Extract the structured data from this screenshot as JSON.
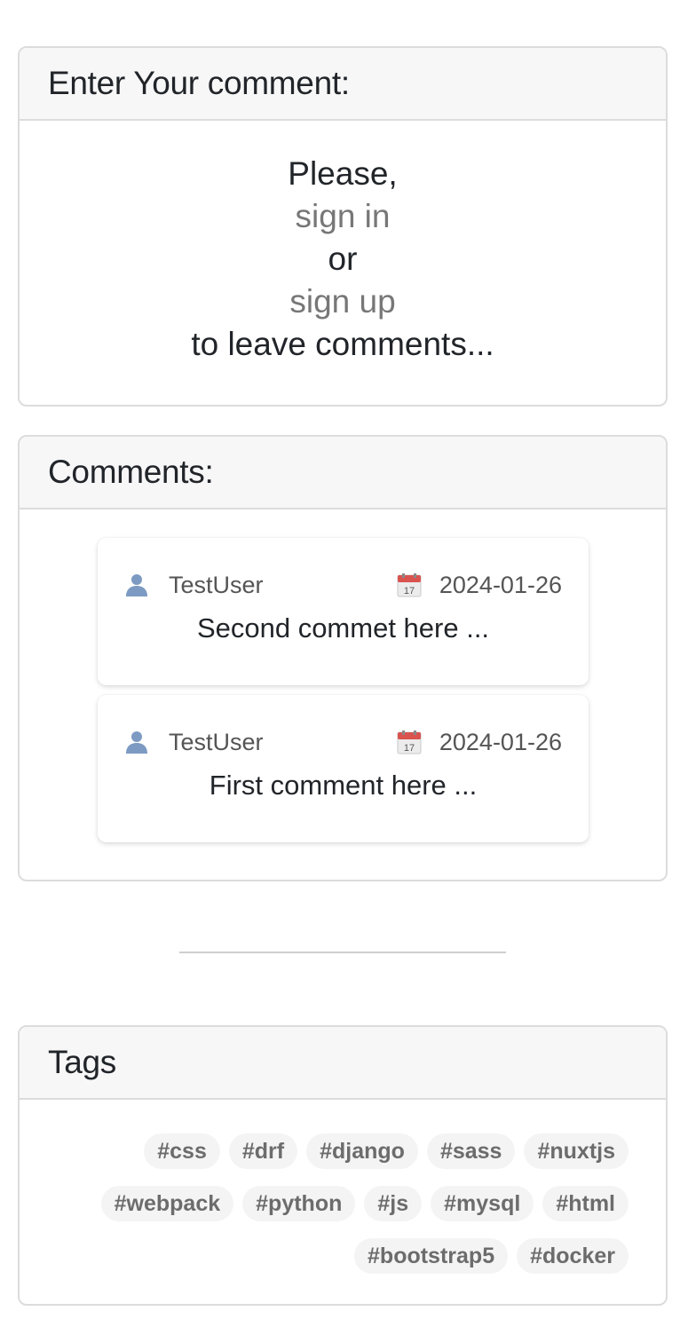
{
  "enter_comment": {
    "title": "Enter Your comment:",
    "prompt_please": "Please,",
    "sign_in_link": "sign in",
    "or_text": "or",
    "sign_up_link": "sign up",
    "prompt_tail": "to leave comments..."
  },
  "comments": {
    "title": "Comments:",
    "items": [
      {
        "author": "TestUser",
        "date": "2024-01-26",
        "text": "Second commet here ..."
      },
      {
        "author": "TestUser",
        "date": "2024-01-26",
        "text": "First comment here ..."
      }
    ],
    "icons": {
      "author": "user-icon",
      "date": "calendar-icon"
    }
  },
  "tags": {
    "title": "Tags",
    "items": [
      "#css",
      "#drf",
      "#django",
      "#sass",
      "#nuxtjs",
      "#webpack",
      "#python",
      "#js",
      "#mysql",
      "#html",
      "#bootstrap5",
      "#docker"
    ]
  },
  "colors": {
    "card_border": "#dcdcdc",
    "card_header_bg": "#f7f7f7",
    "link_muted": "#777777",
    "tag_bg": "#f4f4f4",
    "tag_text": "#6c6c6c"
  }
}
